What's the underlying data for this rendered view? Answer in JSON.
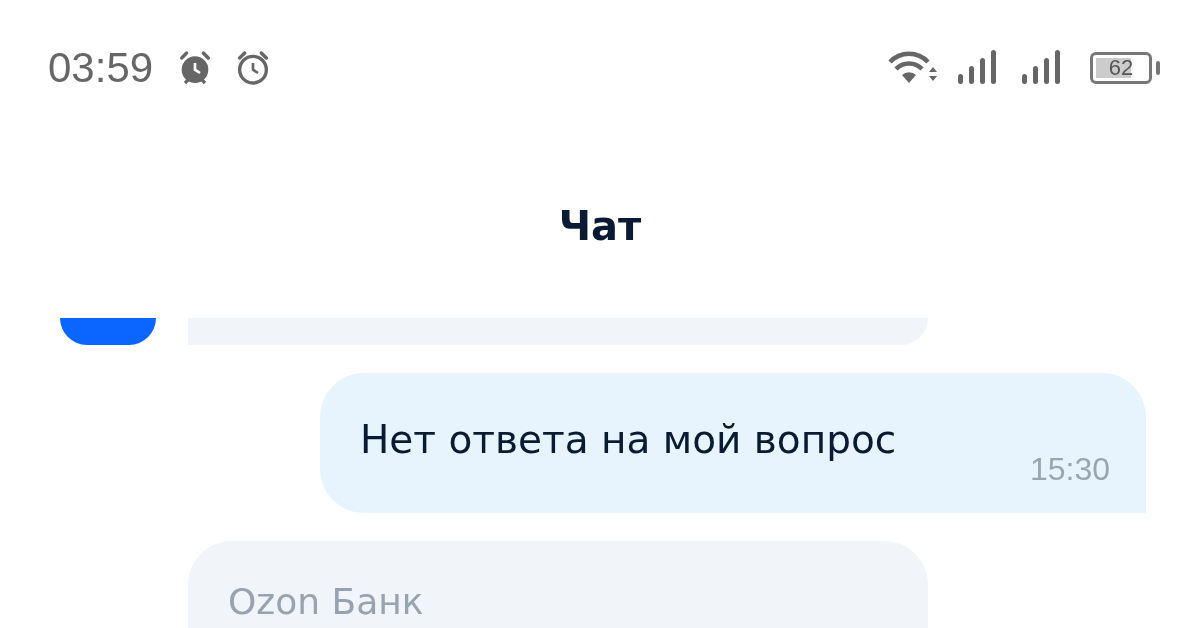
{
  "status_bar": {
    "time": "03:59",
    "battery": "62"
  },
  "header": {
    "title": "Чат"
  },
  "messages": [
    {
      "kind": "incoming-partial"
    },
    {
      "kind": "outgoing",
      "text": "Нет ответа на мой вопрос",
      "time": "15:30"
    },
    {
      "kind": "incoming",
      "sender": "Ozon Банк"
    }
  ]
}
